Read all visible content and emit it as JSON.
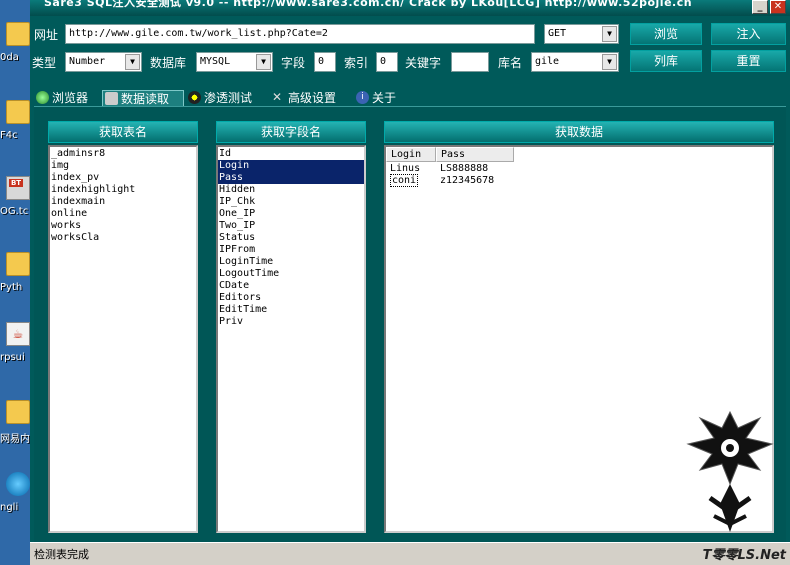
{
  "window": {
    "title": "Sare3 SQL注入安全测试 v9.0 -- http://www.sare3.com.cn/   Crack by LKou[LCG]  http://www.52pojie.cn"
  },
  "desktop": {
    "icons": [
      {
        "caption": "0da"
      },
      {
        "caption": "F4c"
      },
      {
        "caption": "OG.tc"
      },
      {
        "caption": "Pyth"
      },
      {
        "caption": "rpsui"
      },
      {
        "caption": "网易内"
      },
      {
        "caption": "ngli"
      }
    ]
  },
  "toolbar": {
    "url_label": "网址",
    "url_value": "http://www.gile.com.tw/work_list.php?Cate=2",
    "method": "GET",
    "type_label": "类型",
    "type_value": "Number",
    "db_label": "数据库",
    "db_value": "MYSQL",
    "field_label": "字段",
    "field_value": "0",
    "index_label": "索引",
    "index_value": "0",
    "keyword_label": "关键字",
    "keyword_value": "",
    "dbname_label": "库名",
    "dbname_value": "gile",
    "browse_btn": "浏览",
    "inject_btn": "注入",
    "listdb_btn": "列库",
    "reset_btn": "重置"
  },
  "tabs": [
    {
      "label": "浏览器"
    },
    {
      "label": "数据读取"
    },
    {
      "label": "渗透测试"
    },
    {
      "label": "高级设置"
    },
    {
      "label": "关于"
    }
  ],
  "panels": {
    "tables_title": "获取表名",
    "tables": [
      "_adminsr8",
      "img",
      "index_pv",
      "indexhighlight",
      "indexmain",
      "online",
      "works",
      "worksCla"
    ],
    "fields_title": "获取字段名",
    "fields": [
      "Id",
      "Login",
      "Pass",
      "Hidden",
      "IP_Chk",
      "One_IP",
      "Two_IP",
      "Status",
      "IPFrom",
      "LoginTime",
      "LogoutTime",
      "CDate",
      "Editors",
      "EditTime",
      "Priv"
    ],
    "data_title": "获取数据",
    "columns": [
      "Login",
      "Pass"
    ],
    "rows": [
      [
        "Linus",
        "LS888888"
      ],
      [
        "coni",
        "z12345678"
      ]
    ]
  },
  "status": {
    "text": "检测表完成",
    "brand": "T零零LS.Net"
  },
  "colors": {
    "window_bg": "#005a5a",
    "button_teal": "#047474",
    "selection": "#0a246a"
  }
}
